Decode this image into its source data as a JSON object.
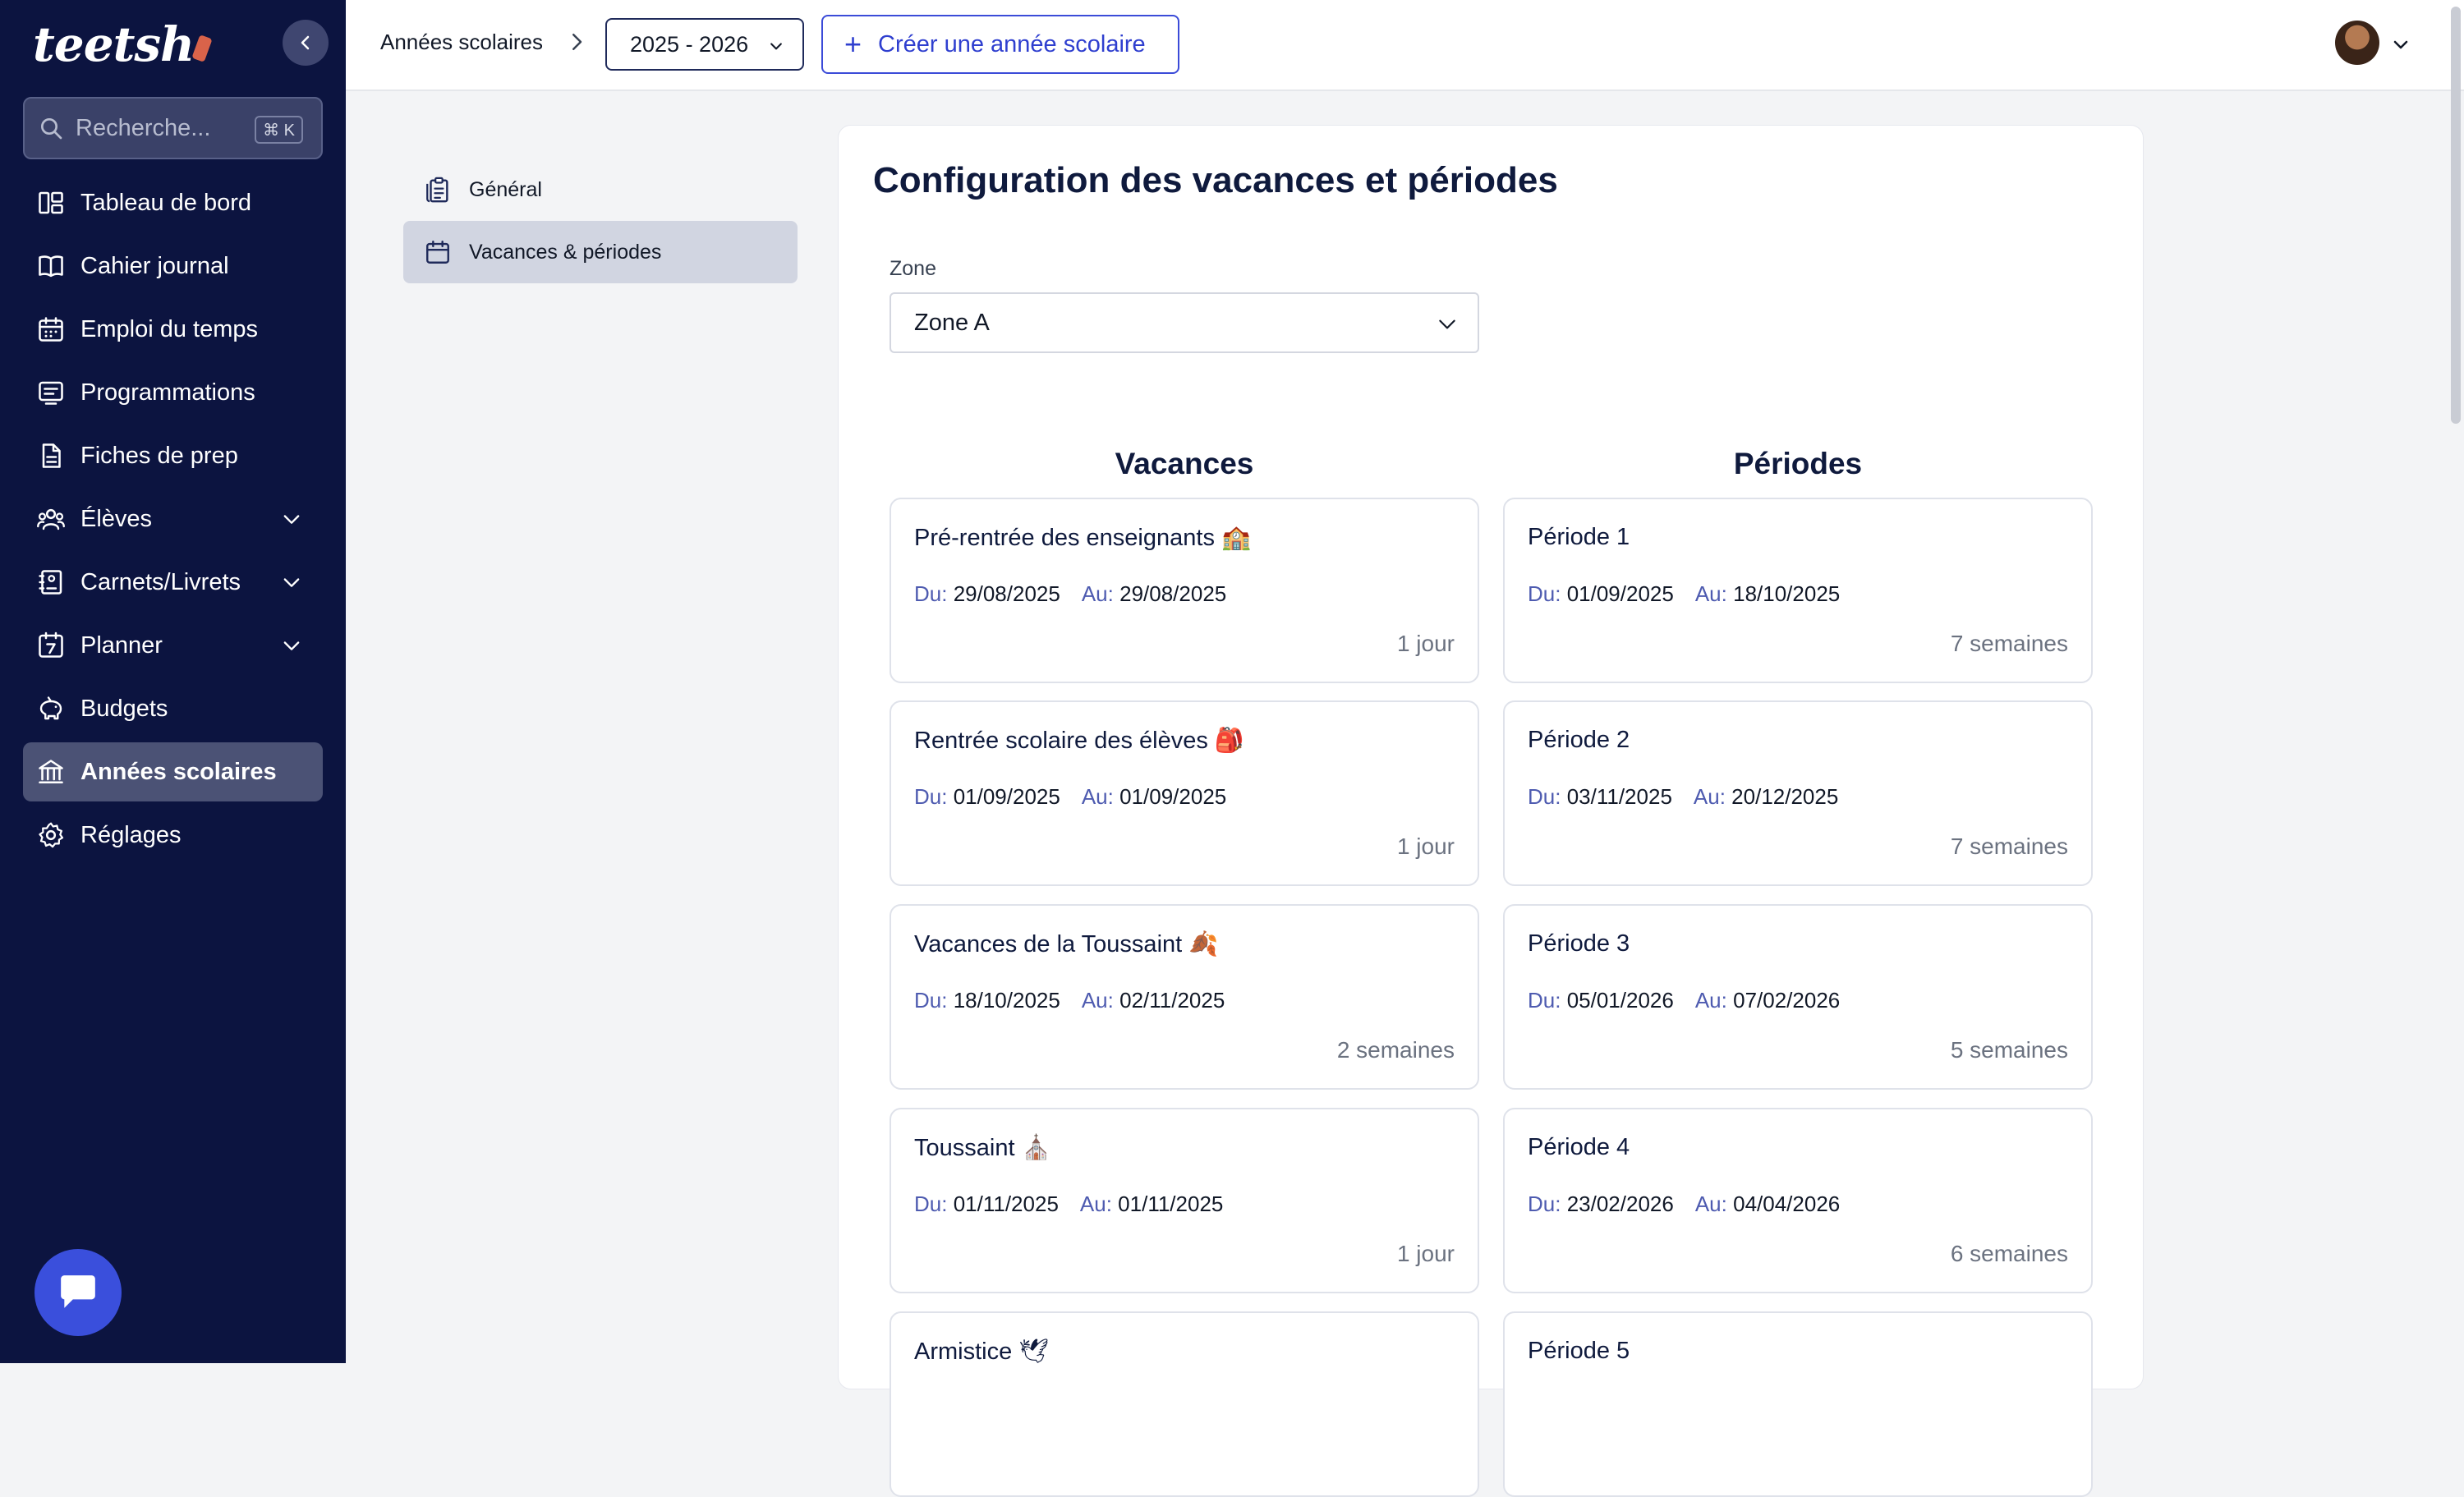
{
  "sidebar": {
    "logo_text": "teetsh",
    "search_placeholder": "Recherche...",
    "search_shortcut": "⌘ K",
    "items": [
      {
        "label": "Tableau de bord",
        "icon": "dashboard-icon"
      },
      {
        "label": "Cahier journal",
        "icon": "book-icon"
      },
      {
        "label": "Emploi du temps",
        "icon": "calendar-icon"
      },
      {
        "label": "Programmations",
        "icon": "board-icon"
      },
      {
        "label": "Fiches de prep",
        "icon": "document-icon"
      },
      {
        "label": "Élèves",
        "icon": "users-icon",
        "expandable": true
      },
      {
        "label": "Carnets/Livrets",
        "icon": "notebook-icon",
        "expandable": true
      },
      {
        "label": "Planner",
        "icon": "planner-icon",
        "expandable": true
      },
      {
        "label": "Budgets",
        "icon": "piggy-bank-icon"
      },
      {
        "label": "Années scolaires",
        "icon": "school-icon",
        "active": true
      },
      {
        "label": "Réglages",
        "icon": "gear-icon"
      }
    ]
  },
  "topbar": {
    "breadcrumb": "Années scolaires",
    "year_selected": "2025 - 2026",
    "create_label": "Créer une année scolaire"
  },
  "subnav": {
    "items": [
      {
        "label": "Général"
      },
      {
        "label": "Vacances & périodes",
        "active": true
      }
    ]
  },
  "main": {
    "title": "Configuration des vacances et périodes",
    "zone_label": "Zone",
    "zone_value": "Zone A",
    "vacances_title": "Vacances",
    "periodes_title": "Périodes",
    "from_label": "Du:",
    "to_label": "Au:",
    "vacances": [
      {
        "name": "Pré-rentrée des enseignants 🏫",
        "from": "29/08/2025",
        "to": "29/08/2025",
        "duration": "1 jour"
      },
      {
        "name": "Rentrée scolaire des élèves 🎒",
        "from": "01/09/2025",
        "to": "01/09/2025",
        "duration": "1 jour"
      },
      {
        "name": "Vacances de la Toussaint 🍂",
        "from": "18/10/2025",
        "to": "02/11/2025",
        "duration": "2 semaines"
      },
      {
        "name": "Toussaint ⛪",
        "from": "01/11/2025",
        "to": "01/11/2025",
        "duration": "1 jour"
      },
      {
        "name": "Armistice 🕊",
        "from": "",
        "to": "",
        "duration": ""
      }
    ],
    "periodes": [
      {
        "name": "Période 1",
        "from": "01/09/2025",
        "to": "18/10/2025",
        "duration": "7 semaines"
      },
      {
        "name": "Période 2",
        "from": "03/11/2025",
        "to": "20/12/2025",
        "duration": "7 semaines"
      },
      {
        "name": "Période 3",
        "from": "05/01/2026",
        "to": "07/02/2026",
        "duration": "5 semaines"
      },
      {
        "name": "Période 4",
        "from": "23/02/2026",
        "to": "04/04/2026",
        "duration": "6 semaines"
      },
      {
        "name": "Période 5",
        "from": "",
        "to": "",
        "duration": ""
      }
    ]
  },
  "colors": {
    "sidebar_bg": "#0c1440",
    "accent": "#3b4bd8",
    "active_nav": "#4b5275"
  }
}
